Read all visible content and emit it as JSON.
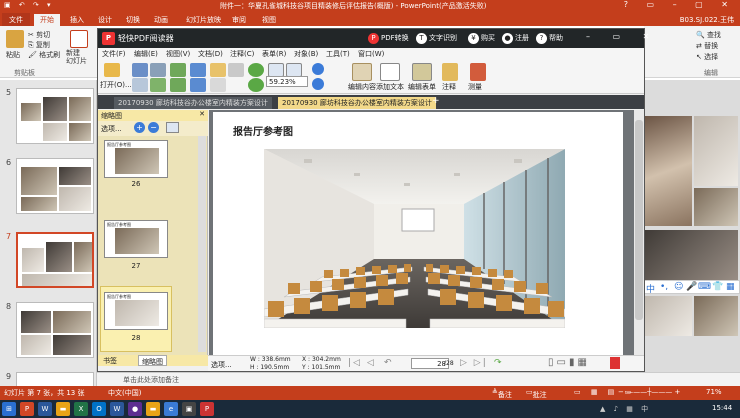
{
  "powerpoint": {
    "window_title": "附件一：华夏孔雀城科技谷项目精装修后评估报告(概版) - PowerPoint(产品激活失败)",
    "tabs": [
      "文件",
      "开始",
      "插入",
      "设计",
      "切换",
      "动画",
      "幻灯片放映",
      "审阅",
      "视图"
    ],
    "user": "B03.SJ.022.王伟",
    "ribbon": {
      "paste": "粘贴",
      "cut": "剪切",
      "copy": "复制",
      "format_painter": "格式刷",
      "new_slide": "新建\n幻灯片",
      "clipboard_group": "剪贴板",
      "find": "查找",
      "replace": "替换",
      "select": "选择",
      "edit_group": "编辑"
    },
    "slides": [
      {
        "num": "5"
      },
      {
        "num": "6"
      },
      {
        "num": "7"
      },
      {
        "num": "8"
      },
      {
        "num": "9"
      }
    ],
    "notes_placeholder": "单击此处添加备注",
    "status": {
      "slide_info": "幻灯片 第 7 张，共 13 张",
      "language": "中文(中国)",
      "notes": "备注",
      "comments": "批注",
      "zoom": "71%"
    }
  },
  "taskbar": {
    "time": "15:44"
  },
  "pdf_reader": {
    "title": "轻快PDF阅读器",
    "top_buttons": {
      "convert": "PDF转换",
      "ocr": "文字识别",
      "buy": "购买",
      "register": "注册",
      "help": "帮助"
    },
    "menu": [
      "文件(F)",
      "编辑(E)",
      "视图(V)",
      "文档(D)",
      "注释(C)",
      "表单(R)",
      "对象(B)",
      "工具(T)",
      "窗口(W)"
    ],
    "toolbar": {
      "open": "打开(O)...",
      "zoom": "59.23%",
      "edit_content": "编辑内容",
      "add_text": "添加文本",
      "edit_form": "编辑表单",
      "annotate": "注释",
      "measure": "测量"
    },
    "doc_tabs": [
      {
        "label": "20170930 廊坊科技谷办公楼室内精装方案设计",
        "active": false
      },
      {
        "label": "20170930 廊坊科技谷办公楼室内精装方案设计",
        "active": true
      }
    ],
    "thumb_pane": {
      "header": "缩略图",
      "options": "选项...",
      "pages": [
        {
          "label": "26",
          "title": "报告厅参考图"
        },
        {
          "label": "27",
          "title": "报告厅参考图"
        },
        {
          "label": "28",
          "title": "报告厅参考图",
          "selected": true
        }
      ],
      "bottom_tabs": [
        "书签",
        "缩略图"
      ]
    },
    "document": {
      "heading": "报告厅参考图"
    },
    "statusbar": {
      "options": "选项...",
      "width": "W : 338.6mm",
      "height": "H : 190.5mm",
      "x": "X : 304.2mm",
      "y": "Y : 101.5mm",
      "page": "28",
      "page_total": "/28"
    }
  }
}
